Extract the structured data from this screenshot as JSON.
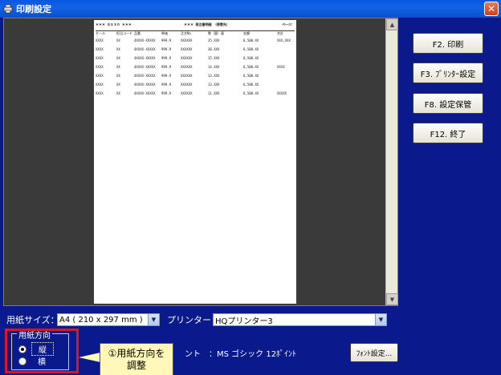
{
  "window": {
    "title": "印刷設定",
    "close_label": "✕"
  },
  "preview": {
    "header_left": "＊＊＊  ＧＳ３０  ＊＊＊",
    "header_mid": "＊＊＊  発注書明細  （得意先）",
    "header_right": "ページ：",
    "columns": [
      "セール",
      "担当コード",
      "品番",
      "単価",
      "注文No",
      "数（量）量",
      "金額",
      "合計"
    ],
    "rows": [
      [
        "XXXX",
        "XX",
        "4XXXX-XXXXX",
        "999.9",
        "XXXXXX",
        "35.XXX",
        "6,500.XX",
        "XXX,XXX"
      ],
      [
        "XXXX",
        "XX",
        "4XXXX-XXXXX",
        "999.9",
        "XXXXXX",
        "30.XXX",
        "6,500.XX",
        ""
      ],
      [
        "XXXX",
        "XX",
        "4XXXX-XXXXX",
        "999.9",
        "XXXXXX",
        "15.XXX",
        "6,500.XX",
        ""
      ],
      [
        "XXXX",
        "XX",
        "4XXXX-XXXXX",
        "999.9",
        "XXXXXX",
        "14.XXX",
        "6,500.XX",
        "XXXX"
      ],
      [
        "XXXX",
        "XX",
        "4XXXX-XXXXX",
        "999.9",
        "XXXXXX",
        "13.XXX",
        "6,500.XX",
        ""
      ],
      [
        "XXXX",
        "XX",
        "4XXXX-XXXXX",
        "999.9",
        "XXXXXX",
        "13.XXX",
        "6,500.XX",
        ""
      ],
      [
        "XXXX",
        "XX",
        "4XXXX-XXXXX",
        "999.9",
        "XXXXXX",
        "11.XXX",
        "6,500.XX",
        "XXXXX"
      ]
    ]
  },
  "buttons": {
    "print": "F2. 印刷",
    "printer_setup": "F3. ﾌﾟﾘﾝﾀｰ設定",
    "save_settings": "F8. 設定保管",
    "exit": "F12. 終了",
    "font_setup": "ﾌｫﾝﾄ設定..."
  },
  "settings": {
    "paper_size_label": "用紙サイズ：",
    "paper_size_value": "A4 ( 210 x 297 mm )",
    "printer_label": "プリンター：",
    "printer_value": "HQプリンター3",
    "font_text": "ント　：MS ゴシック  12ﾎﾟｲﾝﾄ"
  },
  "orientation": {
    "legend": "用紙方向",
    "portrait": "縦",
    "landscape": "横"
  },
  "callout": {
    "text": "①用紙方向を調整"
  }
}
